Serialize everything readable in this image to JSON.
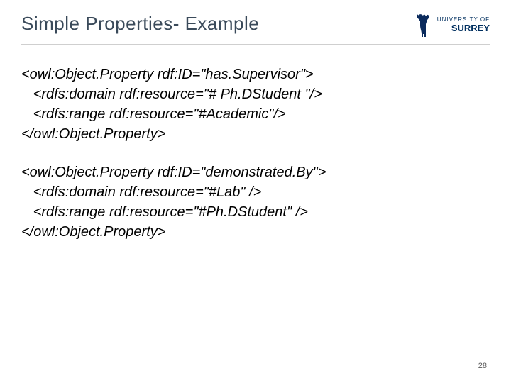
{
  "header": {
    "title": "Simple Properties- Example",
    "logo": {
      "univ": "UNIVERSITY OF",
      "name": "SURREY",
      "icon": "stag-icon"
    }
  },
  "code": {
    "block1": {
      "line1": "<owl:Object.Property rdf:ID=\"has.Supervisor\">",
      "line2": "   <rdfs:domain rdf:resource=\"# Ph.DStudent \"/>",
      "line3": "   <rdfs:range rdf:resource=\"#Academic\"/>",
      "line4": "</owl:Object.Property>"
    },
    "block2": {
      "line1": "<owl:Object.Property rdf:ID=\"demonstrated.By\">",
      "line2": "   <rdfs:domain rdf:resource=\"#Lab\" />",
      "line3": "   <rdfs:range rdf:resource=\"#Ph.DStudent\" />",
      "line4": "</owl:Object.Property>"
    }
  },
  "footer": {
    "slideNumber": "28"
  }
}
